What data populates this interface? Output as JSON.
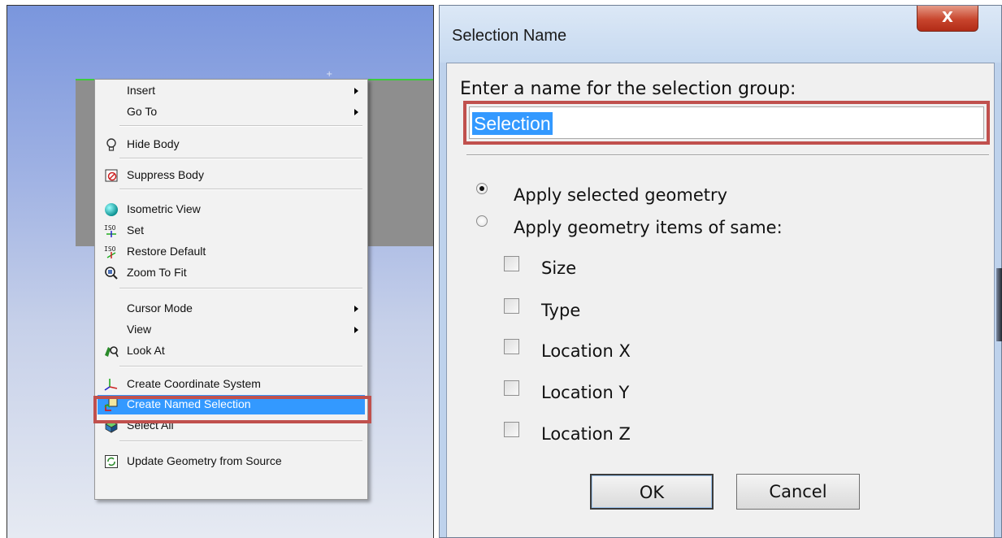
{
  "context_menu": {
    "items": [
      {
        "label": "Insert",
        "has_submenu": true
      },
      {
        "label": "Go To",
        "has_submenu": true
      },
      {
        "label": "Hide Body",
        "icon": "lightbulb-icon"
      },
      {
        "label": "Suppress Body",
        "icon": "suppress-icon"
      },
      {
        "label": "Isometric View",
        "icon": "sphere-icon"
      },
      {
        "label": "Set",
        "icon": "iso-set-icon"
      },
      {
        "label": "Restore Default",
        "icon": "iso-restore-icon"
      },
      {
        "label": "Zoom To Fit",
        "icon": "zoom-fit-icon"
      },
      {
        "label": "Cursor Mode",
        "has_submenu": true
      },
      {
        "label": "View",
        "has_submenu": true
      },
      {
        "label": "Look At",
        "icon": "look-at-icon"
      },
      {
        "label": "Create Coordinate System",
        "icon": "coordinate-system-icon"
      },
      {
        "label": "Create Named Selection",
        "icon": "named-selection-icon",
        "highlighted": true
      },
      {
        "label": "Select All",
        "icon": "select-all-icon"
      },
      {
        "label": "Update Geometry from Source",
        "icon": "update-geometry-icon"
      }
    ],
    "highlight_color": "#3399ff",
    "outline_color": "#c0504d"
  },
  "dialog": {
    "title": "Selection Name",
    "close_label": "X",
    "prompt": "Enter a name for the selection group:",
    "name_value": "Selection",
    "radio_options": [
      {
        "label": "Apply selected geometry",
        "checked": true
      },
      {
        "label": "Apply geometry items of same:",
        "checked": false
      }
    ],
    "checkboxes": [
      {
        "label": "Size",
        "checked": false
      },
      {
        "label": "Type",
        "checked": false
      },
      {
        "label": "Location X",
        "checked": false
      },
      {
        "label": "Location Y",
        "checked": false
      },
      {
        "label": "Location Z",
        "checked": false
      }
    ],
    "ok_label": "OK",
    "cancel_label": "Cancel"
  }
}
